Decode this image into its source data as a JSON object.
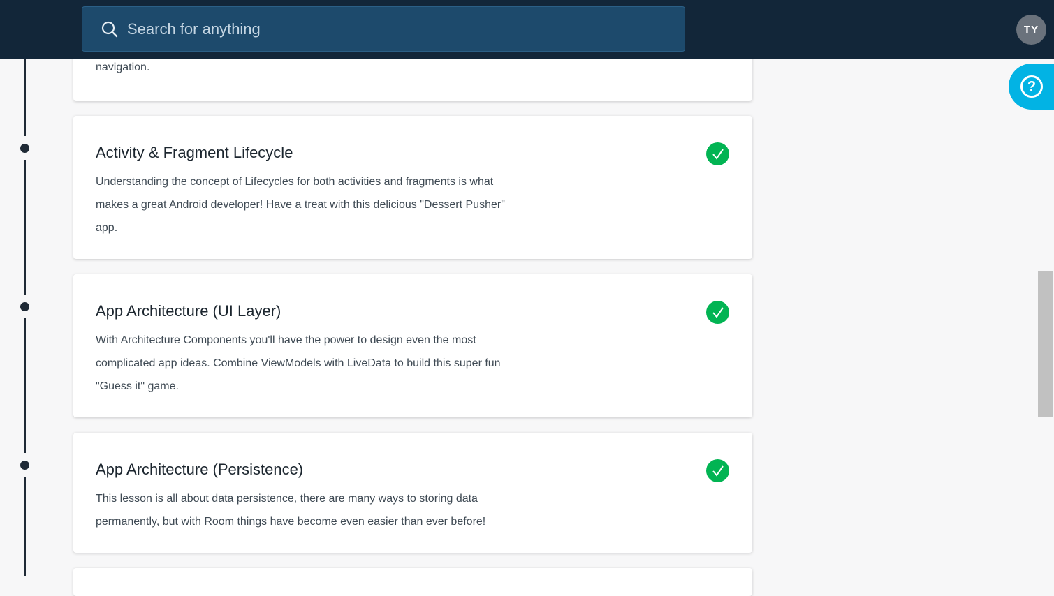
{
  "header": {
    "search_placeholder": "Search for anything",
    "avatar_initials": "TY"
  },
  "previous_card": {
    "desc_tail": "navigation."
  },
  "lessons": [
    {
      "title": "Activity & Fragment Lifecycle",
      "desc_lines": [
        "Understanding the concept of Lifecycles for both activities and fragments is what",
        "makes a great Android developer! Have a treat with this delicious \"Dessert Pusher\"",
        "app."
      ],
      "completed": true
    },
    {
      "title": "App Architecture (UI Layer)",
      "desc_lines": [
        "With Architecture Components you'll have the power to design even the most",
        "complicated app ideas. Combine ViewModels with LiveData to build this super fun",
        "\"Guess it\" game."
      ],
      "completed": true
    },
    {
      "title": "App Architecture (Persistence)",
      "desc_lines": [
        "This lesson is all about data persistence, there are many ways to storing data",
        "permanently, but with Room things have become even easier than ever before!"
      ],
      "completed": true
    }
  ],
  "help": {
    "glyph": "?"
  },
  "colors": {
    "header_bg": "#122639",
    "search_bg": "#1d4a6c",
    "check_green": "#02b453",
    "help_blue": "#02b3e4"
  }
}
